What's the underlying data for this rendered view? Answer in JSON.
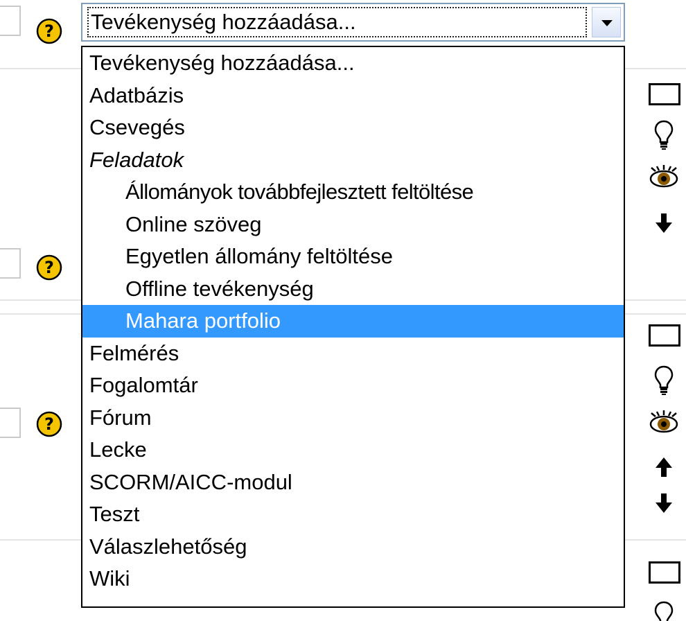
{
  "activity_select": {
    "selected_label": "Tevékenység hozzáadása...",
    "options": [
      "Tevékenység hozzáadása...",
      "Adatbázis",
      "Csevegés",
      "Feladatok",
      "Állományok továbbfejlesztett feltöltése",
      "Online szöveg",
      "Egyetlen állomány feltöltése",
      "Offline tevékenység",
      "Mahara portfolio",
      "Felmérés",
      "Fogalomtár",
      "Fórum",
      "Lecke",
      "SCORM/AICC-modul",
      "Teszt",
      "Válaszlehetőség",
      "Wiki"
    ],
    "highlighted_option": "Mahara portfolio"
  },
  "icons": {
    "help": "help-icon",
    "checkbox": "checkbox-icon",
    "lightbulb": "lightbulb-icon",
    "eye": "eye-icon",
    "arrow_up": "arrow-up-icon",
    "arrow_down": "arrow-down-icon"
  },
  "colors": {
    "highlight": "#3399ff",
    "help_icon_fill": "#f5c400",
    "select_border": "#7f9db9",
    "eye_iris": "#8b5a00"
  }
}
